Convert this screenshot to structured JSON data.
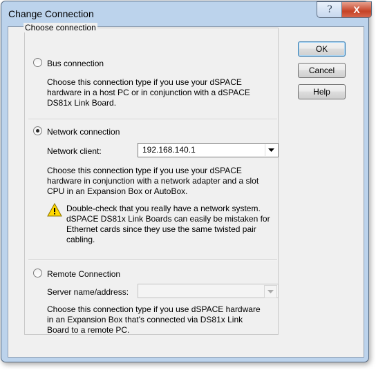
{
  "window": {
    "title": "Change Connection",
    "help_glyph": "?",
    "close_glyph": "X"
  },
  "group": {
    "label": "Choose connection"
  },
  "bus": {
    "label": "Bus connection",
    "selected": false,
    "description": "Choose this connection type if you use your dSPACE hardware in a host PC or in conjunction with a dSPACE DS81x Link Board."
  },
  "network": {
    "label": "Network connection",
    "selected": true,
    "client_label": "Network client:",
    "client_value": "192.168.140.1",
    "description": "Choose this connection type if you use your dSPACE hardware in conjunction with a network adapter and a slot CPU in an Expansion Box or AutoBox.",
    "warning": "Double-check that you really have a network system. dSPACE DS81x Link Boards can easily be mistaken for Ethernet cards since they use the same twisted pair cabling."
  },
  "remote": {
    "label": "Remote Connection",
    "selected": false,
    "server_label": "Server name/address:",
    "server_value": "",
    "description": "Choose this connection type if you use dSPACE hardware in an Expansion Box that's connected via DS81x Link Board to a remote PC."
  },
  "buttons": {
    "ok": "OK",
    "cancel": "Cancel",
    "help": "Help"
  },
  "colors": {
    "warning_fill": "#ffd800",
    "close_red": "#c64327"
  }
}
